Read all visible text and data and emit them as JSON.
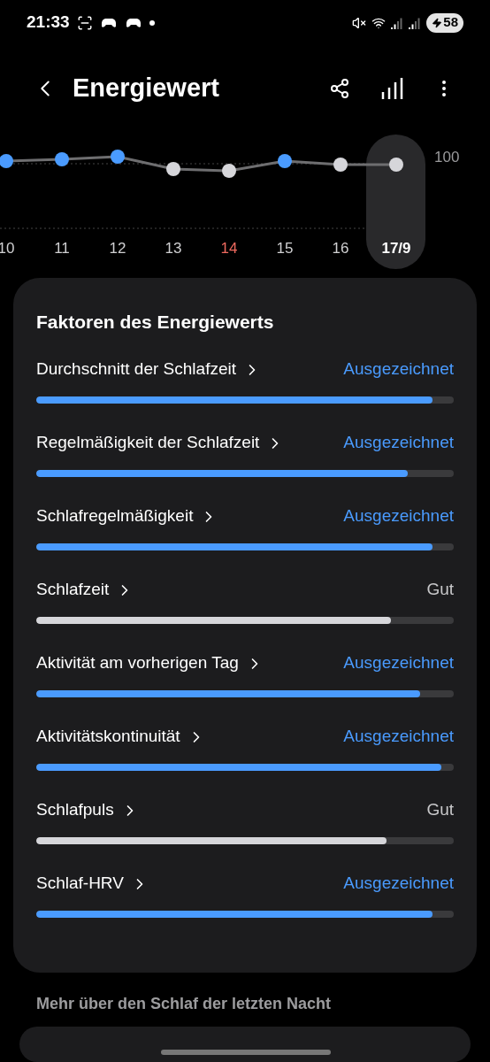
{
  "status_bar": {
    "time": "21:33",
    "battery": "58"
  },
  "header": {
    "title": "Energiewert"
  },
  "chart": {
    "max_label": "100",
    "points": [
      {
        "label": "10",
        "color": "#4a9bff",
        "selected": false,
        "sunday": false
      },
      {
        "label": "11",
        "color": "#4a9bff",
        "selected": false,
        "sunday": false
      },
      {
        "label": "12",
        "color": "#4a9bff",
        "selected": false,
        "sunday": false
      },
      {
        "label": "13",
        "color": "#d6d6da",
        "selected": false,
        "sunday": false
      },
      {
        "label": "14",
        "color": "#d6d6da",
        "selected": false,
        "sunday": true
      },
      {
        "label": "15",
        "color": "#4a9bff",
        "selected": false,
        "sunday": false
      },
      {
        "label": "16",
        "color": "#d6d6da",
        "selected": false,
        "sunday": false
      },
      {
        "label": "17/9",
        "color": "#d6d6da",
        "selected": true,
        "sunday": false
      }
    ]
  },
  "factors": {
    "title": "Faktoren des Energiewerts",
    "items": [
      {
        "name": "Durchschnitt der Schlafzeit",
        "rating": "Ausgezeichnet",
        "color": "#4a9bff",
        "level": 0.95
      },
      {
        "name": "Regelmäßigkeit der Schlafzeit",
        "rating": "Ausgezeichnet",
        "color": "#4a9bff",
        "level": 0.89
      },
      {
        "name": "Schlafregelmäßigkeit",
        "rating": "Ausgezeichnet",
        "color": "#4a9bff",
        "level": 0.95
      },
      {
        "name": "Schlafzeit",
        "rating": "Gut",
        "color": "#d6d6da",
        "level": 0.85
      },
      {
        "name": "Aktivität am vorherigen Tag",
        "rating": "Ausgezeichnet",
        "color": "#4a9bff",
        "level": 0.92
      },
      {
        "name": "Aktivitätskontinuität",
        "rating": "Ausgezeichnet",
        "color": "#4a9bff",
        "level": 0.97
      },
      {
        "name": "Schlafpuls",
        "rating": "Gut",
        "color": "#d6d6da",
        "level": 0.84
      },
      {
        "name": "Schlaf-HRV",
        "rating": "Ausgezeichnet",
        "color": "#4a9bff",
        "level": 0.95
      }
    ]
  },
  "more_section": {
    "title": "Mehr über den Schlaf der letzten Nacht"
  }
}
